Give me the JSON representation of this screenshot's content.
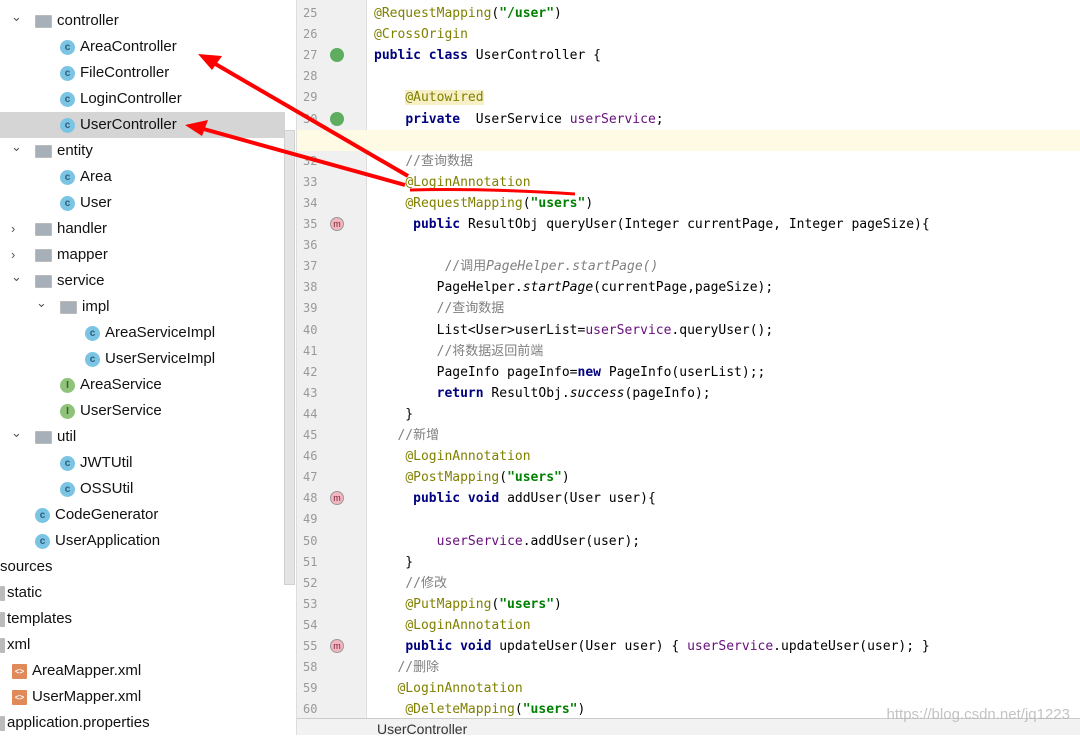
{
  "tree": [
    {
      "label": "controller",
      "type": "folder",
      "expanded": true,
      "level": 1
    },
    {
      "label": "AreaController",
      "type": "class",
      "level": 2
    },
    {
      "label": "FileController",
      "type": "class",
      "level": 2
    },
    {
      "label": "LoginController",
      "type": "class",
      "level": 2
    },
    {
      "label": "UserController",
      "type": "class",
      "level": 2,
      "selected": true
    },
    {
      "label": "entity",
      "type": "folder",
      "expanded": true,
      "level": 1
    },
    {
      "label": "Area",
      "type": "class",
      "level": 2
    },
    {
      "label": "User",
      "type": "class",
      "level": 2
    },
    {
      "label": "handler",
      "type": "folder",
      "expanded": false,
      "level": 1
    },
    {
      "label": "mapper",
      "type": "folder",
      "expanded": false,
      "level": 1
    },
    {
      "label": "service",
      "type": "folder",
      "expanded": true,
      "level": 1
    },
    {
      "label": "impl",
      "type": "folder",
      "expanded": true,
      "level": 2
    },
    {
      "label": "AreaServiceImpl",
      "type": "class",
      "level": 3
    },
    {
      "label": "UserServiceImpl",
      "type": "class",
      "level": 3
    },
    {
      "label": "AreaService",
      "type": "interface",
      "level": 2
    },
    {
      "label": "UserService",
      "type": "interface",
      "level": 2
    },
    {
      "label": "util",
      "type": "folder",
      "expanded": true,
      "level": 1
    },
    {
      "label": "JWTUtil",
      "type": "class",
      "level": 2
    },
    {
      "label": "OSSUtil",
      "type": "class",
      "level": 2
    },
    {
      "label": "CodeGenerator",
      "type": "class",
      "level": 1
    },
    {
      "label": "UserApplication",
      "type": "class",
      "level": 1
    },
    {
      "label": "sources",
      "type": "none",
      "level": -2
    },
    {
      "label": "static",
      "type": "file",
      "level": -1
    },
    {
      "label": "templates",
      "type": "file",
      "level": -1
    },
    {
      "label": "xml",
      "type": "file",
      "level": -1
    },
    {
      "label": "AreaMapper.xml",
      "type": "xml",
      "level": 0
    },
    {
      "label": "UserMapper.xml",
      "type": "xml",
      "level": 0
    },
    {
      "label": "application.properties",
      "type": "file",
      "level": -1
    }
  ],
  "code": [
    {
      "n": "25",
      "t": [
        [
          "ann",
          "@RequestMapping"
        ],
        [
          "txt",
          "("
        ],
        [
          "str",
          "\"/user\""
        ],
        [
          "txt",
          ")"
        ]
      ]
    },
    {
      "n": "26",
      "t": [
        [
          "ann",
          "@CrossOrigin"
        ]
      ]
    },
    {
      "n": "27",
      "g": "spring",
      "t": [
        [
          "kw",
          "public class "
        ],
        [
          "txt",
          "UserController {"
        ]
      ]
    },
    {
      "n": "28",
      "t": []
    },
    {
      "n": "29",
      "t": [
        [
          "txt",
          "    "
        ],
        [
          "ann annbg",
          "@Autowired"
        ]
      ]
    },
    {
      "n": "30",
      "g": "spring",
      "t": [
        [
          "txt",
          "    "
        ],
        [
          "kw",
          "private"
        ],
        [
          "txt",
          "  UserService "
        ],
        [
          "fld",
          "userService"
        ],
        [
          "txt",
          ";"
        ]
      ]
    },
    {
      "n": "31",
      "cur": true,
      "t": []
    },
    {
      "n": "32",
      "t": [
        [
          "txt",
          "    "
        ],
        [
          "cmt",
          "//查询数据"
        ]
      ]
    },
    {
      "n": "33",
      "t": [
        [
          "txt",
          "    "
        ],
        [
          "ann",
          "@LoginAnnotation"
        ]
      ]
    },
    {
      "n": "34",
      "t": [
        [
          "txt",
          "    "
        ],
        [
          "ann",
          "@RequestMapping"
        ],
        [
          "txt",
          "("
        ],
        [
          "str",
          "\"users\""
        ],
        [
          "txt",
          ")"
        ]
      ]
    },
    {
      "n": "35",
      "g": "m",
      "t": [
        [
          "txt",
          "     "
        ],
        [
          "kw",
          "public "
        ],
        [
          "txt",
          "ResultObj queryUser(Integer currentPage, Integer pageSize){"
        ]
      ]
    },
    {
      "n": "36",
      "t": []
    },
    {
      "n": "37",
      "t": [
        [
          "txt",
          "         "
        ],
        [
          "cmt",
          "//调用"
        ],
        [
          "cmtit",
          "PageHelper.startPage()"
        ]
      ]
    },
    {
      "n": "38",
      "t": [
        [
          "txt",
          "        PageHelper."
        ],
        [
          "it",
          "startPage"
        ],
        [
          "txt",
          "(currentPage,pageSize);"
        ]
      ]
    },
    {
      "n": "39",
      "t": [
        [
          "txt",
          "        "
        ],
        [
          "cmt",
          "//查询数据"
        ]
      ]
    },
    {
      "n": "40",
      "t": [
        [
          "txt",
          "        List<User>userList="
        ],
        [
          "fld",
          "userService"
        ],
        [
          "txt",
          ".queryUser();"
        ]
      ]
    },
    {
      "n": "41",
      "t": [
        [
          "txt",
          "        "
        ],
        [
          "cmt",
          "//将数据返回前端"
        ]
      ]
    },
    {
      "n": "42",
      "t": [
        [
          "txt",
          "        PageInfo pageInfo="
        ],
        [
          "kw",
          "new "
        ],
        [
          "txt",
          "PageInfo(userList);;"
        ]
      ]
    },
    {
      "n": "43",
      "t": [
        [
          "txt",
          "        "
        ],
        [
          "kw",
          "return "
        ],
        [
          "txt",
          "ResultObj."
        ],
        [
          "it",
          "success"
        ],
        [
          "txt",
          "(pageInfo);"
        ]
      ]
    },
    {
      "n": "44",
      "t": [
        [
          "txt",
          "    }"
        ]
      ]
    },
    {
      "n": "45",
      "t": [
        [
          "txt",
          "   "
        ],
        [
          "cmt",
          "//新增"
        ]
      ]
    },
    {
      "n": "46",
      "t": [
        [
          "txt",
          "    "
        ],
        [
          "ann",
          "@LoginAnnotation"
        ]
      ]
    },
    {
      "n": "47",
      "t": [
        [
          "txt",
          "    "
        ],
        [
          "ann",
          "@PostMapping"
        ],
        [
          "txt",
          "("
        ],
        [
          "str",
          "\"users\""
        ],
        [
          "txt",
          ")"
        ]
      ]
    },
    {
      "n": "48",
      "g": "m",
      "t": [
        [
          "txt",
          "     "
        ],
        [
          "kw",
          "public void "
        ],
        [
          "txt",
          "addUser(User user){"
        ]
      ]
    },
    {
      "n": "49",
      "t": []
    },
    {
      "n": "50",
      "t": [
        [
          "txt",
          "        "
        ],
        [
          "fld",
          "userService"
        ],
        [
          "txt",
          ".addUser(user);"
        ]
      ]
    },
    {
      "n": "51",
      "t": [
        [
          "txt",
          "    }"
        ]
      ]
    },
    {
      "n": "52",
      "t": [
        [
          "txt",
          "    "
        ],
        [
          "cmt",
          "//修改"
        ]
      ]
    },
    {
      "n": "53",
      "t": [
        [
          "txt",
          "    "
        ],
        [
          "ann",
          "@PutMapping"
        ],
        [
          "txt",
          "("
        ],
        [
          "str",
          "\"users\""
        ],
        [
          "txt",
          ")"
        ]
      ]
    },
    {
      "n": "54",
      "t": [
        [
          "txt",
          "    "
        ],
        [
          "ann",
          "@LoginAnnotation"
        ]
      ]
    },
    {
      "n": "55",
      "g": "m",
      "t": [
        [
          "txt",
          "    "
        ],
        [
          "kw",
          "public void "
        ],
        [
          "txt",
          "updateUser(User user) { "
        ],
        [
          "fld",
          "userService"
        ],
        [
          "txt",
          ".updateUser(user); }"
        ]
      ]
    },
    {
      "n": "58",
      "t": [
        [
          "txt",
          "   "
        ],
        [
          "cmt",
          "//删除"
        ]
      ]
    },
    {
      "n": "59",
      "t": [
        [
          "txt",
          "   "
        ],
        [
          "ann",
          "@LoginAnnotation"
        ]
      ]
    },
    {
      "n": "60",
      "t": [
        [
          "txt",
          "    "
        ],
        [
          "ann",
          "@DeleteMapping"
        ],
        [
          "txt",
          "("
        ],
        [
          "str",
          "\"users\""
        ],
        [
          "txt",
          ")"
        ]
      ]
    }
  ],
  "editor_tab": "UserController",
  "watermark": "https://blog.csdn.net/jq1223",
  "annotation_color": "#ff0000"
}
